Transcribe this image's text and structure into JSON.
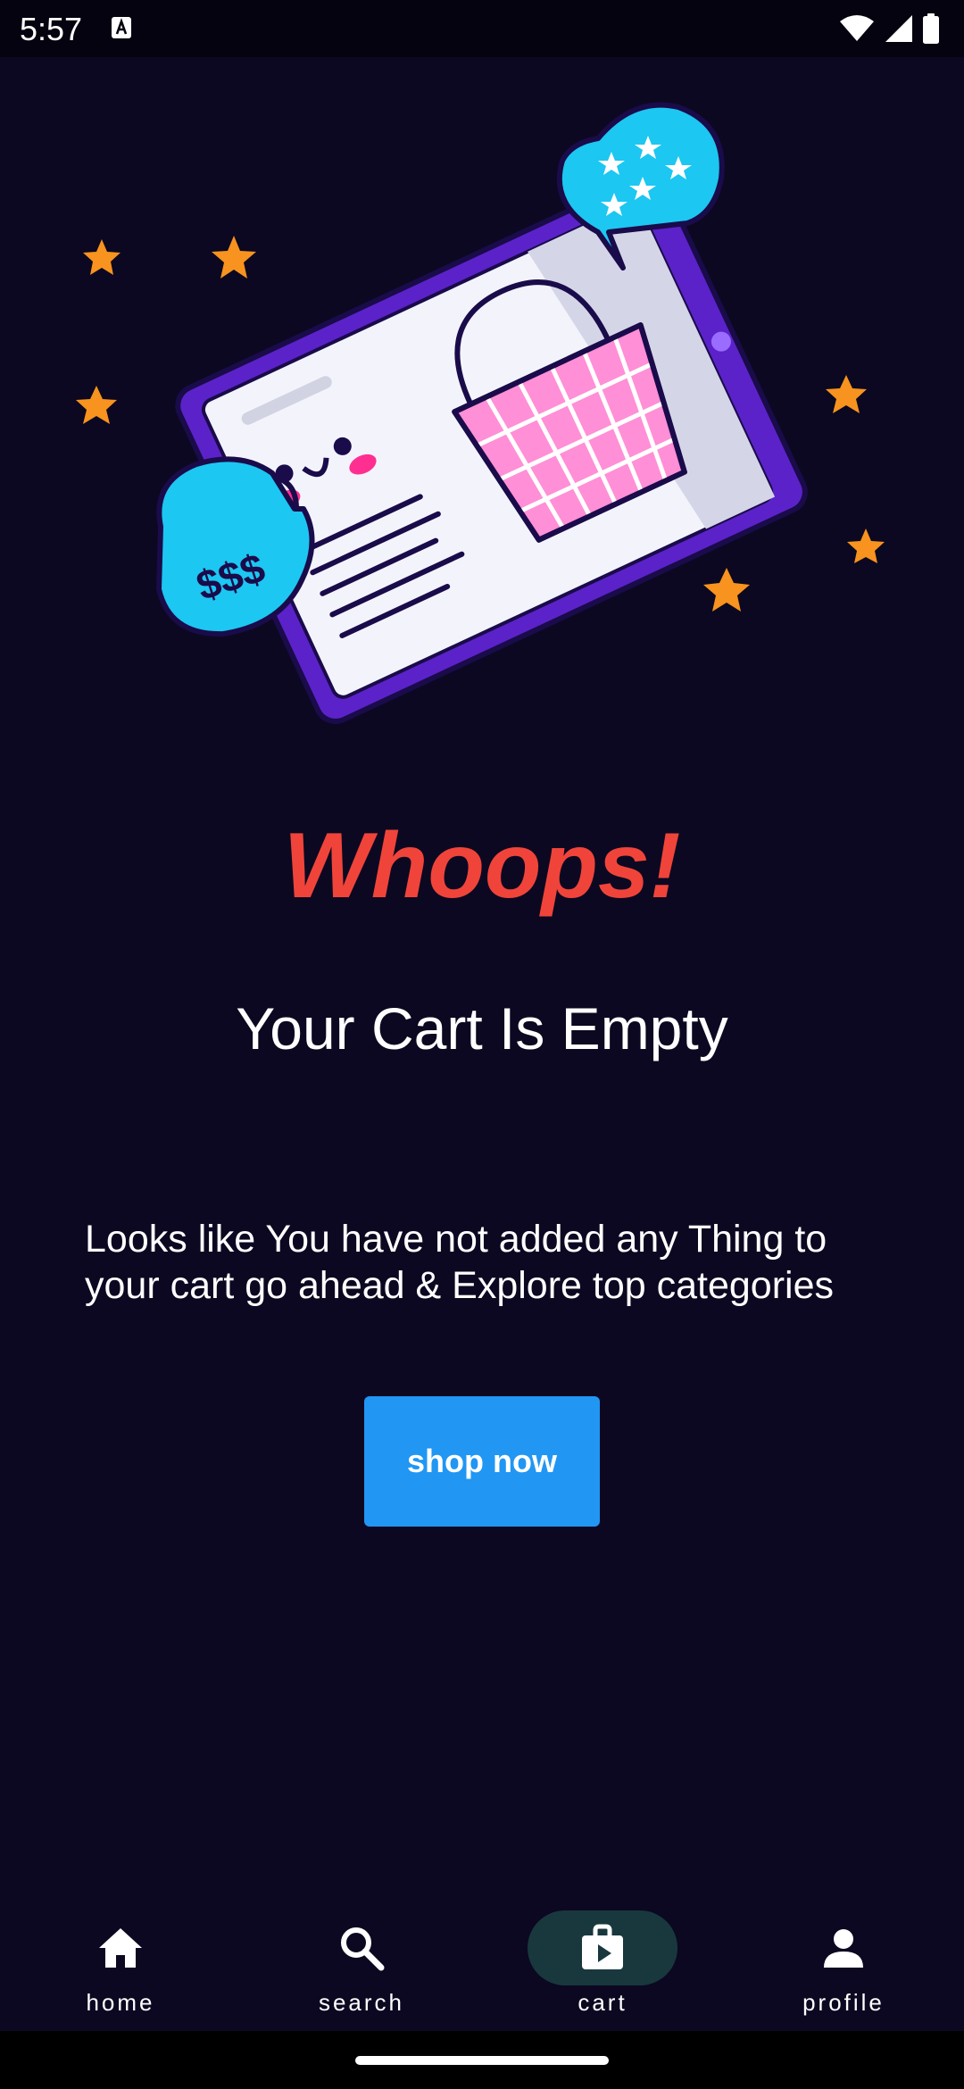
{
  "status_bar": {
    "time": "5:57",
    "icons": [
      "text-recognition-icon",
      "wifi-icon",
      "cell-signal-icon",
      "battery-icon"
    ]
  },
  "illustration": {
    "icon": "empty-cart-illustration",
    "badge_text": "$$$"
  },
  "content": {
    "title": "Whoops!",
    "subtitle": "Your Cart Is Empty",
    "description": "Looks like You have not added any Thing to your cart go ahead & Explore top categories",
    "button_label": "shop now"
  },
  "bottom_nav": {
    "items": [
      {
        "label": "home",
        "icon": "home-icon",
        "active": false
      },
      {
        "label": "search",
        "icon": "search-icon",
        "active": false
      },
      {
        "label": "cart",
        "icon": "shopping-bag-icon",
        "active": true
      },
      {
        "label": "profile",
        "icon": "person-icon",
        "active": false
      }
    ]
  },
  "colors": {
    "background": "#0c0821",
    "title": "#f0443a",
    "button": "#2196f3",
    "active_pill": "#18383e"
  }
}
